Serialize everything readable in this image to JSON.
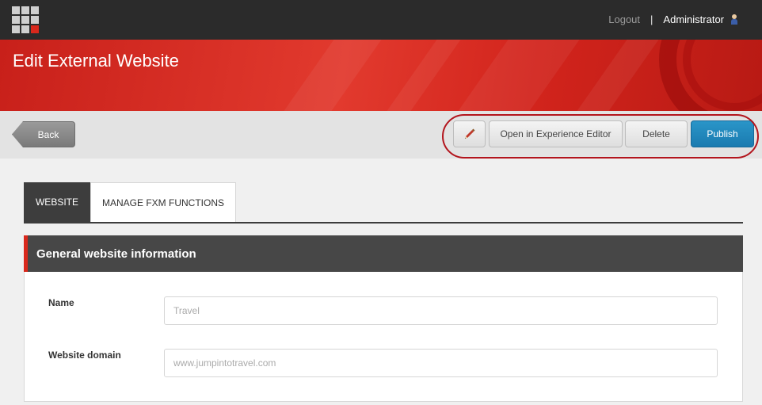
{
  "topbar": {
    "logout_label": "Logout",
    "separator": "|",
    "user_name": "Administrator",
    "icons": {
      "launcher": "app-launcher-grid-icon",
      "user": "user-avatar-icon"
    }
  },
  "header": {
    "title": "Edit External Website"
  },
  "actions": {
    "back_label": "Back",
    "edit_icon": "pencil-icon",
    "open_experience_editor_label": "Open in Experience Editor",
    "delete_label": "Delete",
    "publish_label": "Publish"
  },
  "tabs": [
    {
      "label": "WEBSITE",
      "active": true
    },
    {
      "label": "MANAGE FXM FUNCTIONS",
      "active": false
    }
  ],
  "panel": {
    "title": "General website information",
    "fields": [
      {
        "label": "Name",
        "value": "",
        "placeholder": "Travel"
      },
      {
        "label": "Website domain",
        "value": "",
        "placeholder": "www.jumpintotravel.com"
      }
    ]
  },
  "colors": {
    "accent_red": "#d9281c",
    "header_red": "#e23a2e",
    "primary_blue": "#1a7bb0",
    "dark_bar": "#2b2b2b"
  }
}
